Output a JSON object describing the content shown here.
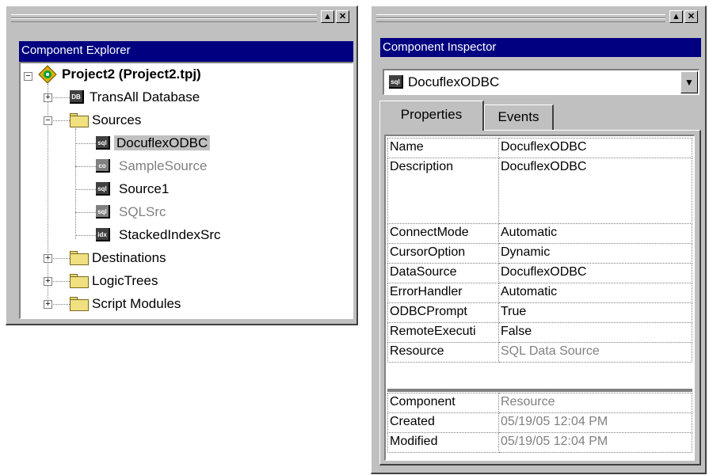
{
  "explorer": {
    "title": "Component Explorer",
    "minimize_label": "▲",
    "close_label": "✕",
    "tree": {
      "project": "Project2 (Project2.tpj)",
      "transall": "TransAll Database",
      "sources": "Sources",
      "source_items": [
        {
          "label": "DocuflexODBC",
          "icon": "sql",
          "selected": true,
          "disabled": false
        },
        {
          "label": "SampleSource",
          "icon": "co",
          "selected": false,
          "disabled": true
        },
        {
          "label": "Source1",
          "icon": "sql",
          "selected": false,
          "disabled": false
        },
        {
          "label": "SQLSrc",
          "icon": "sql",
          "selected": false,
          "disabled": true
        },
        {
          "label": "StackedIndexSrc",
          "icon": "idx",
          "selected": false,
          "disabled": false
        }
      ],
      "destinations": "Destinations",
      "logictrees": "LogicTrees",
      "scriptmodules": "Script Modules",
      "expand_plus": "+",
      "expand_minus": "−"
    }
  },
  "inspector": {
    "title": "Component Inspector",
    "minimize_label": "▲",
    "close_label": "✕",
    "selected_component": "DocuflexODBC",
    "combo_arrow": "▼",
    "tabs": [
      "Properties",
      "Events"
    ],
    "properties": [
      {
        "name": "Name",
        "value": "DocuflexODBC",
        "grey": false
      },
      {
        "name": "Description",
        "value": "DocuflexODBC",
        "grey": false
      },
      {
        "name": "ConnectMode",
        "value": "Automatic",
        "grey": false
      },
      {
        "name": "CursorOption",
        "value": "Dynamic",
        "grey": false
      },
      {
        "name": "DataSource",
        "value": "DocuflexODBC",
        "grey": false
      },
      {
        "name": "ErrorHandler",
        "value": "Automatic",
        "grey": false
      },
      {
        "name": "ODBCPrompt",
        "value": "True",
        "grey": false
      },
      {
        "name": "RemoteExecuti",
        "value": "False",
        "grey": false
      },
      {
        "name": "Resource",
        "value": "SQL Data Source",
        "grey": true
      }
    ],
    "info": [
      {
        "name": "Component",
        "value": "Resource"
      },
      {
        "name": "Created",
        "value": "05/19/05 12:04 PM"
      },
      {
        "name": "Modified",
        "value": "05/19/05 12:04 PM"
      }
    ]
  },
  "icons": {
    "sql": "sql",
    "co": "co",
    "idx": "idx",
    "db": "DB"
  }
}
